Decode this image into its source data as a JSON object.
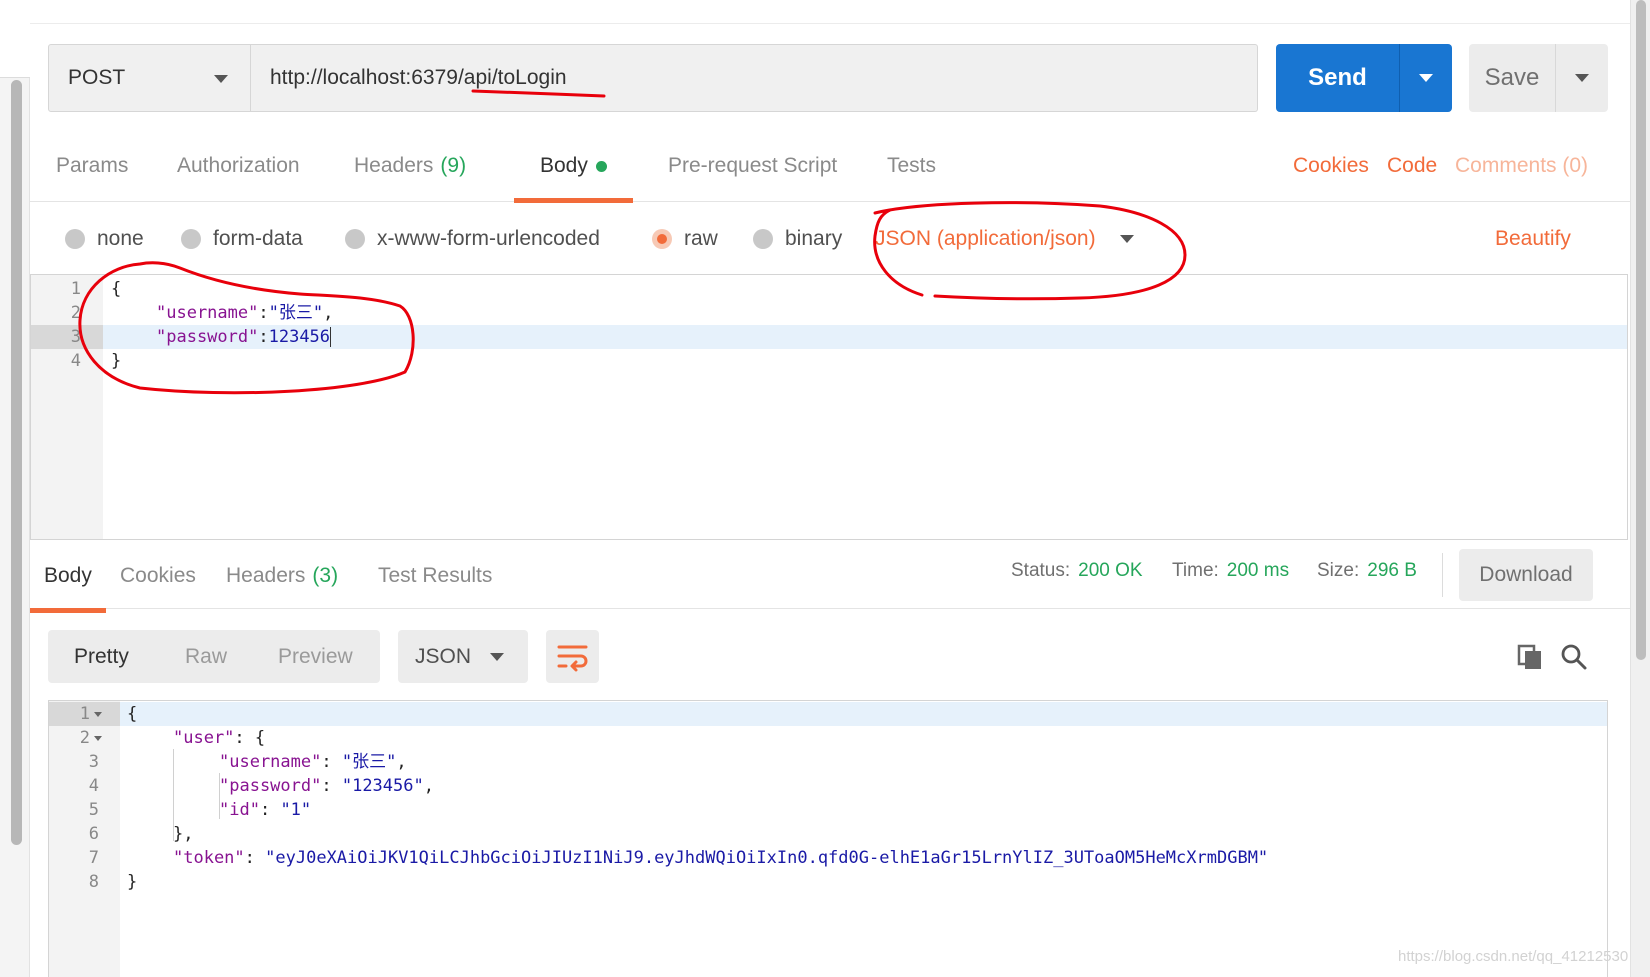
{
  "request": {
    "method": "POST",
    "url": "http://localhost:6379/api/toLogin",
    "send_label": "Send",
    "save_label": "Save"
  },
  "request_tabs": {
    "params": "Params",
    "authorization": "Authorization",
    "headers": "Headers",
    "headers_count": "(9)",
    "body": "Body",
    "prerequest": "Pre-request Script",
    "tests": "Tests",
    "cookies": "Cookies",
    "code": "Code",
    "comments": "Comments (0)"
  },
  "body_options": {
    "none": "none",
    "form_data": "form-data",
    "urlencoded": "x-www-form-urlencoded",
    "raw": "raw",
    "binary": "binary",
    "content_type": "JSON (application/json)",
    "beautify": "Beautify"
  },
  "request_body": {
    "line_numbers": [
      "1",
      "2",
      "3",
      "4"
    ],
    "l1": "{",
    "l2_key": "\"username\"",
    "l2_colon": ":",
    "l2_val": "\"张三\"",
    "l2_comma": ",",
    "l3_key": "\"password\"",
    "l3_colon": ":",
    "l3_val": "123456",
    "l4": "}"
  },
  "response_tabs": {
    "body": "Body",
    "cookies": "Cookies",
    "headers": "Headers",
    "headers_count": "(3)",
    "test_results": "Test Results"
  },
  "response_status": {
    "status_label": "Status:",
    "status_value": "200 OK",
    "time_label": "Time:",
    "time_value": "200 ms",
    "size_label": "Size:",
    "size_value": "296 B",
    "download": "Download"
  },
  "response_toolbar": {
    "pretty": "Pretty",
    "raw": "Raw",
    "preview": "Preview",
    "format": "JSON"
  },
  "response_body": {
    "line_numbers": [
      "1",
      "2",
      "3",
      "4",
      "5",
      "6",
      "7",
      "8"
    ],
    "l1": "{",
    "l2_key": "\"user\"",
    "l2_rest": ": {",
    "l3_key": "\"username\"",
    "l3_colon": ": ",
    "l3_val": "\"张三\"",
    "l3_comma": ",",
    "l4_key": "\"password\"",
    "l4_colon": ": ",
    "l4_val": "\"123456\"",
    "l4_comma": ",",
    "l5_key": "\"id\"",
    "l5_colon": ": ",
    "l5_val": "\"1\"",
    "l6": "},",
    "l7_key": "\"token\"",
    "l7_colon": ": ",
    "l7_val": "\"eyJ0eXAiOiJKV1QiLCJhbGciOiJIUzI1NiJ9.eyJhdWQiOiIxIn0.qfd0G-elhE1aGr15LrnYlIZ_3UToaOM5HeMcXrmDGBM\"",
    "l8": "}"
  },
  "icons": {
    "wrap": "wrap-lines-icon",
    "copy": "copy-icon",
    "search": "search-icon"
  },
  "colors": {
    "accent": "#f26b3a",
    "send": "#1976d2",
    "success": "#26a65b",
    "annotation": "#e8000b"
  },
  "watermark": "https://blog.csdn.net/qq_41212530"
}
